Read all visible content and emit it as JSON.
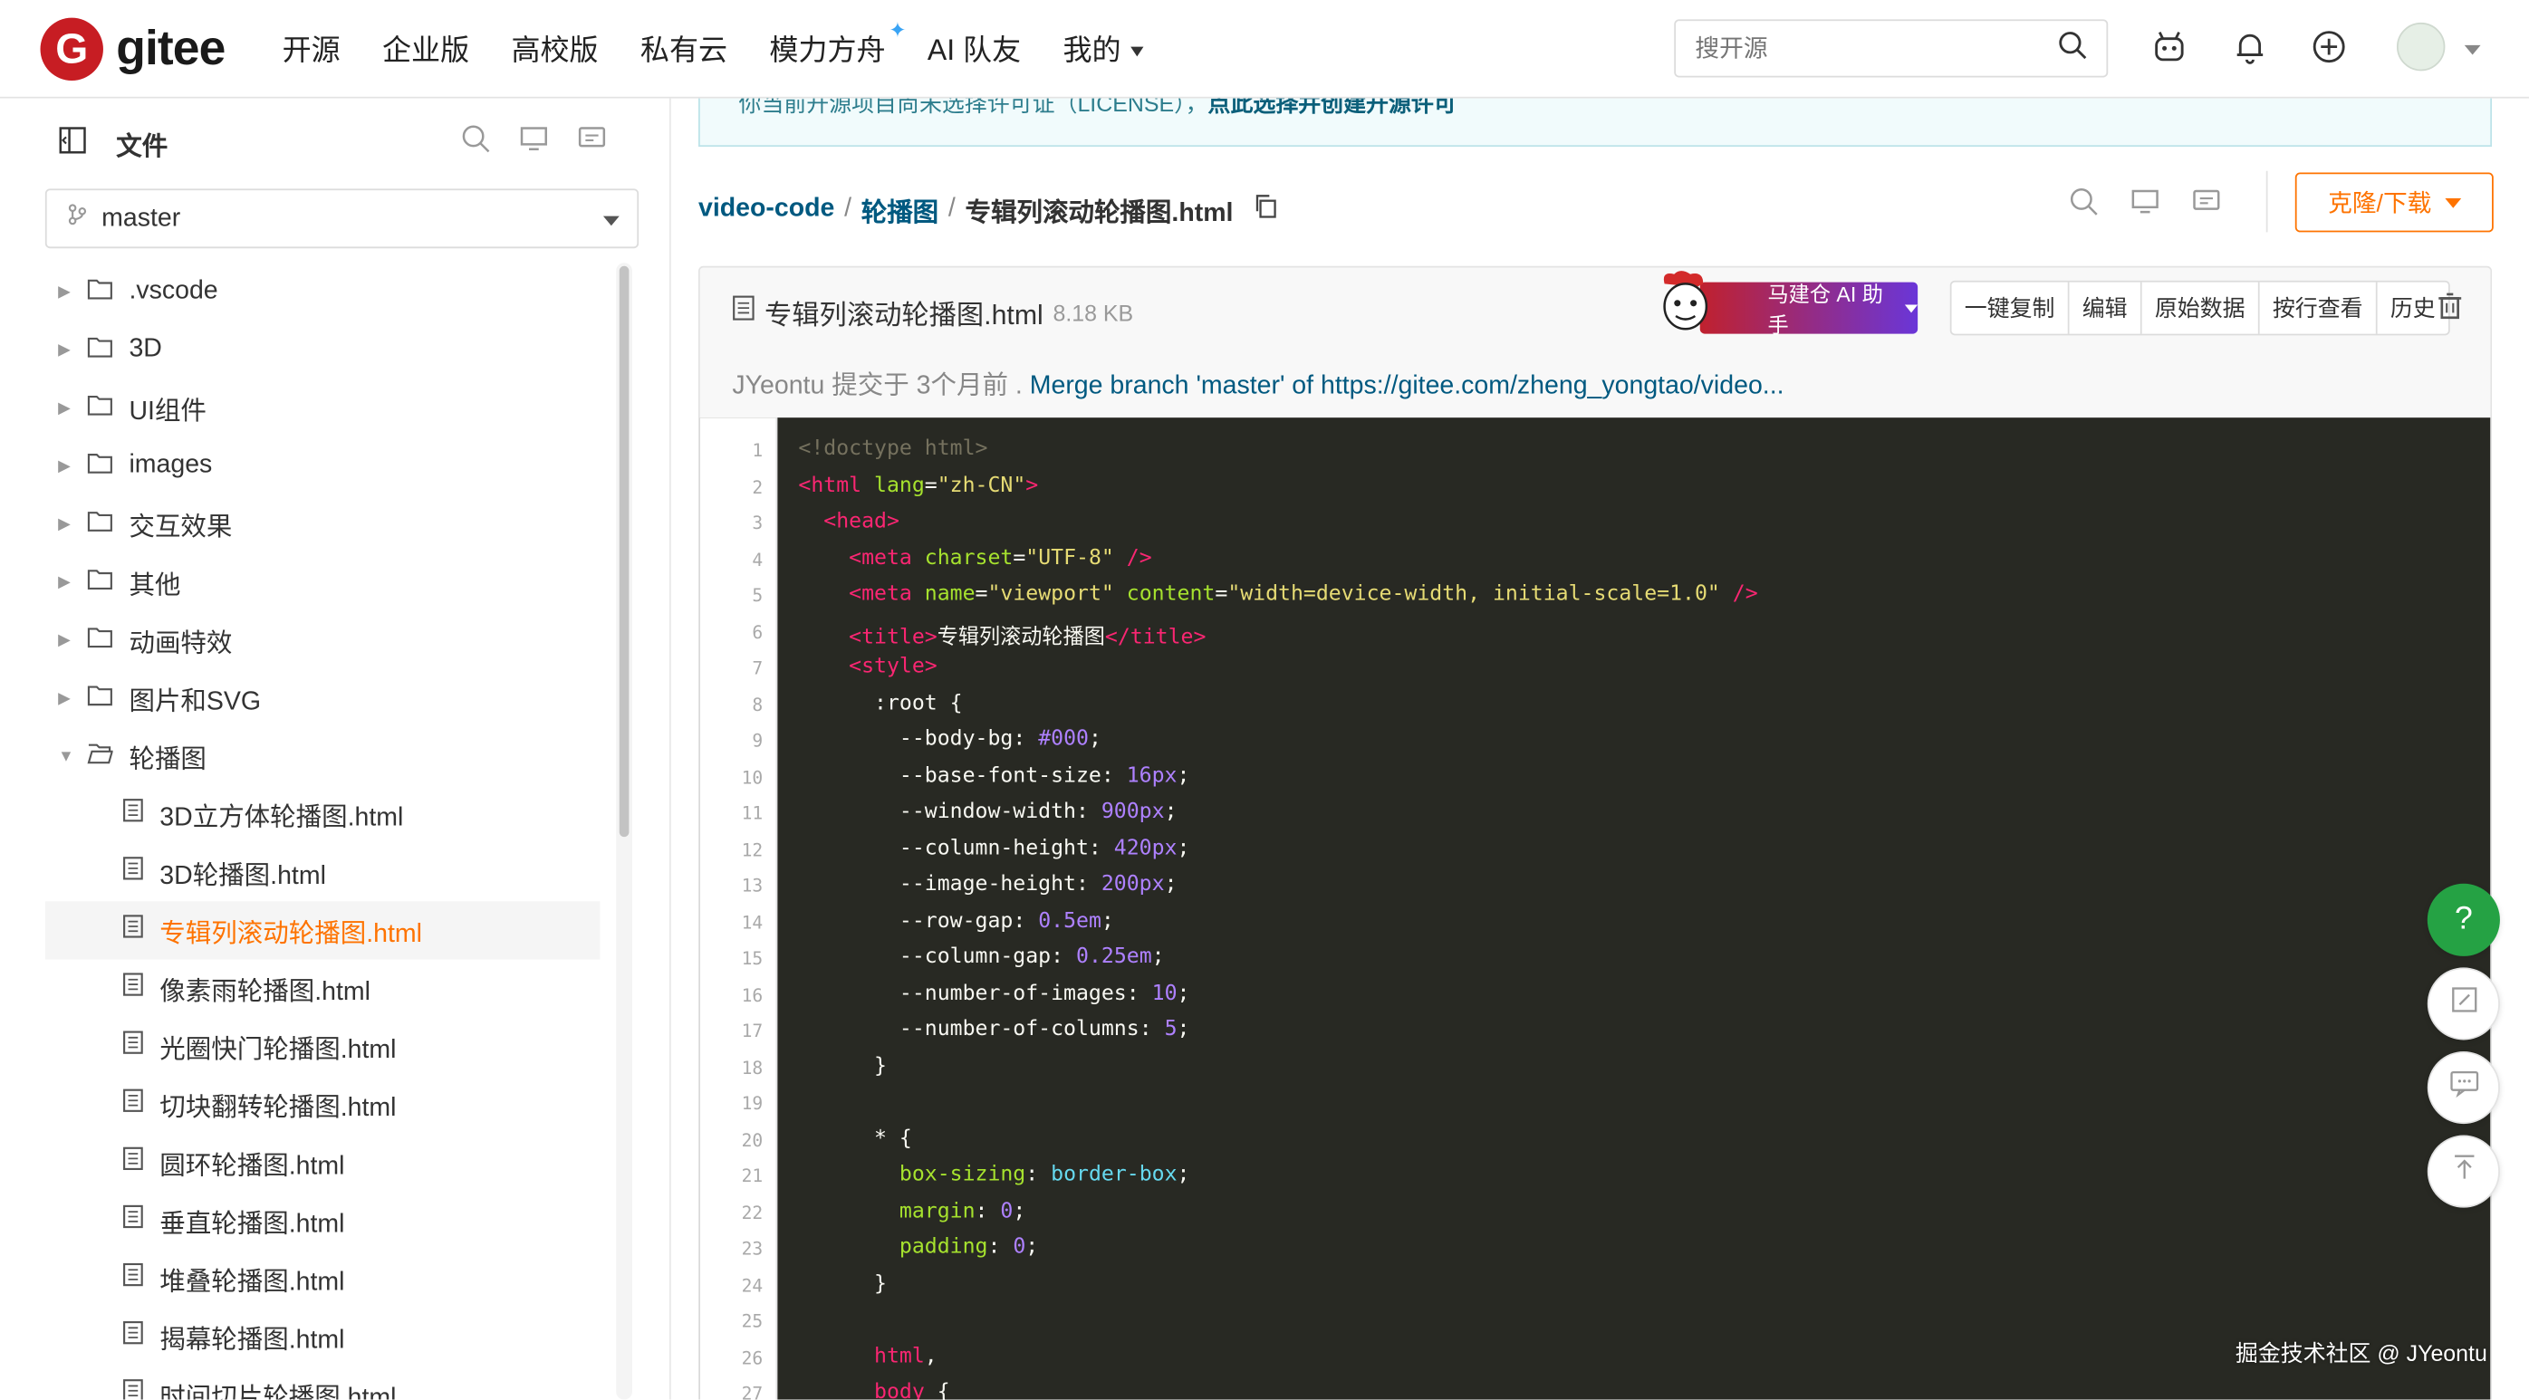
{
  "header": {
    "logo_letter": "G",
    "logo_text": "gitee",
    "nav": [
      "开源",
      "企业版",
      "高校版",
      "私有云",
      "模力方舟",
      "AI 队友",
      "我的"
    ],
    "search_placeholder": "搜开源"
  },
  "sidebar": {
    "title": "文件",
    "branch": "master",
    "tree": [
      {
        "label": ".vscode",
        "type": "folder",
        "open": false
      },
      {
        "label": "3D",
        "type": "folder",
        "open": false
      },
      {
        "label": "UI组件",
        "type": "folder",
        "open": false
      },
      {
        "label": "images",
        "type": "folder",
        "open": false
      },
      {
        "label": "交互效果",
        "type": "folder",
        "open": false
      },
      {
        "label": "其他",
        "type": "folder",
        "open": false
      },
      {
        "label": "动画特效",
        "type": "folder",
        "open": false
      },
      {
        "label": "图片和SVG",
        "type": "folder",
        "open": false
      },
      {
        "label": "轮播图",
        "type": "folder",
        "open": true
      },
      {
        "label": "3D立方体轮播图.html",
        "type": "file"
      },
      {
        "label": "3D轮播图.html",
        "type": "file"
      },
      {
        "label": "专辑列滚动轮播图.html",
        "type": "file",
        "active": true
      },
      {
        "label": "像素雨轮播图.html",
        "type": "file"
      },
      {
        "label": "光圈快门轮播图.html",
        "type": "file"
      },
      {
        "label": "切块翻转轮播图.html",
        "type": "file"
      },
      {
        "label": "圆环轮播图.html",
        "type": "file"
      },
      {
        "label": "垂直轮播图.html",
        "type": "file"
      },
      {
        "label": "堆叠轮播图.html",
        "type": "file"
      },
      {
        "label": "揭幕轮播图.html",
        "type": "file"
      },
      {
        "label": "时间切片轮播图.html",
        "type": "file"
      }
    ]
  },
  "banner": {
    "text": "你当前开源项目尚未选择许可证（LICENSE），",
    "link": "点此选择并创建开源许可"
  },
  "breadcrumb": {
    "repo": "video-code",
    "sep": "/",
    "folder": "轮播图",
    "file": "专辑列滚动轮播图.html"
  },
  "actions": {
    "clone": "克隆/下载"
  },
  "file": {
    "name": "专辑列滚动轮播图.html",
    "size": "8.18 KB",
    "ai_label": "马建仓 AI 助手",
    "buttons": [
      "一键复制",
      "编辑",
      "原始数据",
      "按行查看",
      "历史"
    ],
    "commit_author": "JYeontu",
    "commit_meta": "提交于 3个月前 .",
    "commit_msg": "Merge branch 'master' of https://gitee.com/zheng_yongtao/video..."
  },
  "code_lines": [
    [
      {
        "t": "<!doctype html>",
        "c": "doc"
      }
    ],
    [
      {
        "t": "<html",
        "c": "tag"
      },
      {
        "t": " lang",
        "c": "attr"
      },
      {
        "t": "=",
        "c": ""
      },
      {
        "t": "\"zh-CN\"",
        "c": "str"
      },
      {
        "t": ">",
        "c": "tag"
      }
    ],
    [
      {
        "t": "  <head>",
        "c": "tag"
      }
    ],
    [
      {
        "t": "    <meta",
        "c": "tag"
      },
      {
        "t": " charset",
        "c": "attr"
      },
      {
        "t": "=",
        "c": ""
      },
      {
        "t": "\"UTF-8\"",
        "c": "str"
      },
      {
        "t": " />",
        "c": "tag"
      }
    ],
    [
      {
        "t": "    <meta",
        "c": "tag"
      },
      {
        "t": " name",
        "c": "attr"
      },
      {
        "t": "=",
        "c": ""
      },
      {
        "t": "\"viewport\"",
        "c": "str"
      },
      {
        "t": " content",
        "c": "attr"
      },
      {
        "t": "=",
        "c": ""
      },
      {
        "t": "\"width=device-width, initial-scale=1.0\"",
        "c": "str"
      },
      {
        "t": " />",
        "c": "tag"
      }
    ],
    [
      {
        "t": "    <title>",
        "c": "tag"
      },
      {
        "t": "专辑列滚动轮播图",
        "c": ""
      },
      {
        "t": "</title>",
        "c": "tag"
      }
    ],
    [
      {
        "t": "    <style>",
        "c": "tag"
      }
    ],
    [
      {
        "t": "      :root {",
        "c": ""
      }
    ],
    [
      {
        "t": "        --body-bg",
        "c": ""
      },
      {
        "t": ": ",
        "c": ""
      },
      {
        "t": "#000",
        "c": "num"
      },
      {
        "t": ";",
        "c": ""
      }
    ],
    [
      {
        "t": "        --base-font-size",
        "c": ""
      },
      {
        "t": ": ",
        "c": ""
      },
      {
        "t": "16px",
        "c": "num"
      },
      {
        "t": ";",
        "c": ""
      }
    ],
    [
      {
        "t": "        --window-width",
        "c": ""
      },
      {
        "t": ": ",
        "c": ""
      },
      {
        "t": "900px",
        "c": "num"
      },
      {
        "t": ";",
        "c": ""
      }
    ],
    [
      {
        "t": "        --column-height",
        "c": ""
      },
      {
        "t": ": ",
        "c": ""
      },
      {
        "t": "420px",
        "c": "num"
      },
      {
        "t": ";",
        "c": ""
      }
    ],
    [
      {
        "t": "        --image-height",
        "c": ""
      },
      {
        "t": ": ",
        "c": ""
      },
      {
        "t": "200px",
        "c": "num"
      },
      {
        "t": ";",
        "c": ""
      }
    ],
    [
      {
        "t": "        --row-gap",
        "c": ""
      },
      {
        "t": ": ",
        "c": ""
      },
      {
        "t": "0.5em",
        "c": "num"
      },
      {
        "t": ";",
        "c": ""
      }
    ],
    [
      {
        "t": "        --column-gap",
        "c": ""
      },
      {
        "t": ": ",
        "c": ""
      },
      {
        "t": "0.25em",
        "c": "num"
      },
      {
        "t": ";",
        "c": ""
      }
    ],
    [
      {
        "t": "        --number-of-images",
        "c": ""
      },
      {
        "t": ": ",
        "c": ""
      },
      {
        "t": "10",
        "c": "num"
      },
      {
        "t": ";",
        "c": ""
      }
    ],
    [
      {
        "t": "        --number-of-columns",
        "c": ""
      },
      {
        "t": ": ",
        "c": ""
      },
      {
        "t": "5",
        "c": "num"
      },
      {
        "t": ";",
        "c": ""
      }
    ],
    [
      {
        "t": "      }",
        "c": ""
      }
    ],
    [
      {
        "t": "",
        "c": ""
      }
    ],
    [
      {
        "t": "      * {",
        "c": ""
      }
    ],
    [
      {
        "t": "        box-sizing",
        "c": "attr"
      },
      {
        "t": ": ",
        "c": ""
      },
      {
        "t": "border-box",
        "c": "kw"
      },
      {
        "t": ";",
        "c": ""
      }
    ],
    [
      {
        "t": "        margin",
        "c": "attr"
      },
      {
        "t": ": ",
        "c": ""
      },
      {
        "t": "0",
        "c": "num"
      },
      {
        "t": ";",
        "c": ""
      }
    ],
    [
      {
        "t": "        padding",
        "c": "attr"
      },
      {
        "t": ": ",
        "c": ""
      },
      {
        "t": "0",
        "c": "num"
      },
      {
        "t": ";",
        "c": ""
      }
    ],
    [
      {
        "t": "      }",
        "c": ""
      }
    ],
    [
      {
        "t": "",
        "c": ""
      }
    ],
    [
      {
        "t": "      html",
        "c": "tag"
      },
      {
        "t": ",",
        "c": ""
      }
    ],
    [
      {
        "t": "      body",
        "c": "tag"
      },
      {
        "t": " {",
        "c": ""
      }
    ]
  ],
  "watermark": "掘金技术社区 @ JYeontu",
  "colors": {
    "brand": "#c71d23",
    "accent": "#fe7300",
    "link": "#005980",
    "code_bg": "#282923",
    "help": "#25a244"
  }
}
